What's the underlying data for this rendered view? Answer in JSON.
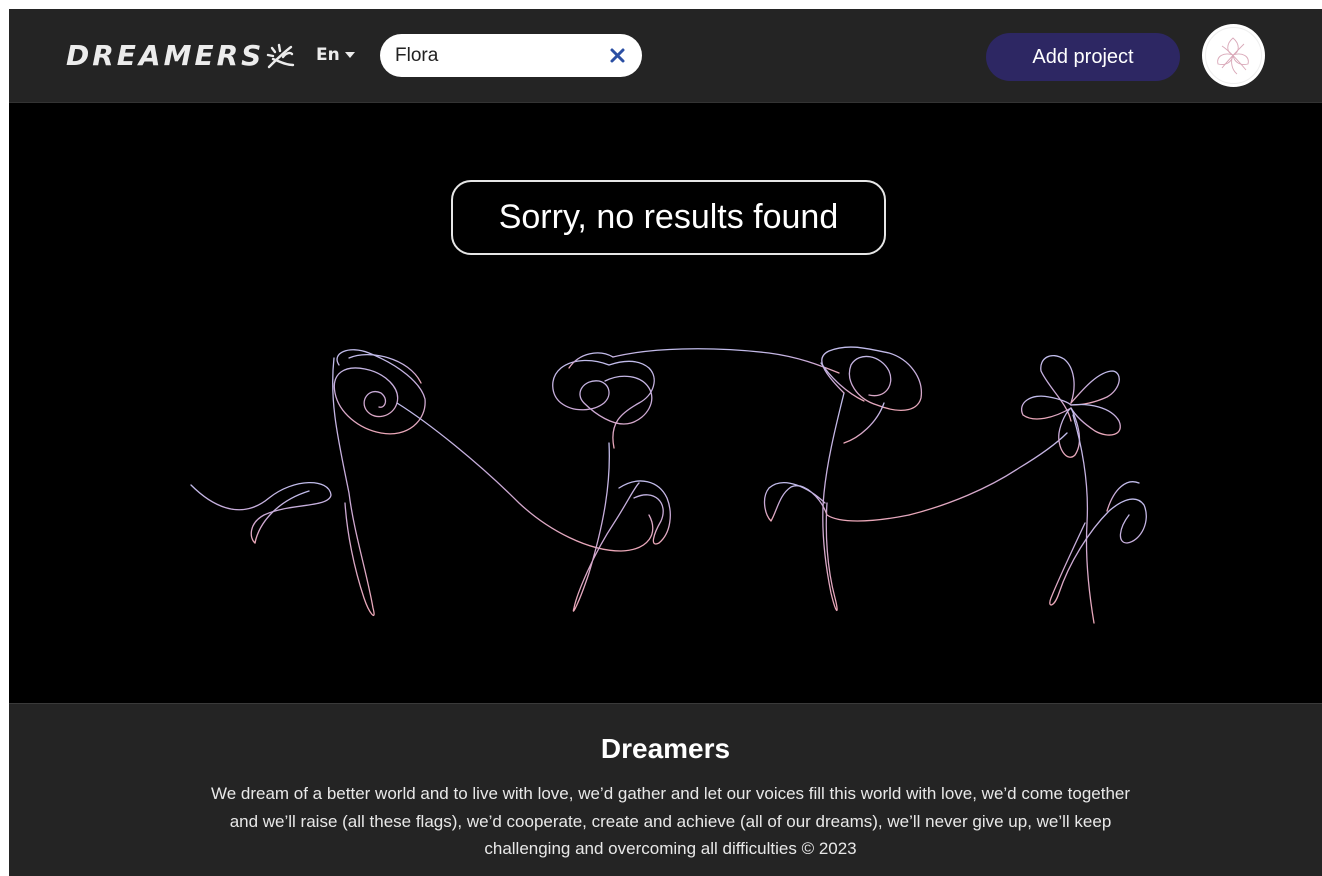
{
  "header": {
    "logo_text": "DREAMERS",
    "logo_icon": "dream-sparkle-icon",
    "language": "En",
    "search": {
      "value": "Flora",
      "placeholder": "",
      "clear_icon": "close-icon"
    },
    "add_project_label": "Add project",
    "avatar_icon": "flower-avatar"
  },
  "main": {
    "message": "Sorry, no results found",
    "illustration": "line-art-flowers"
  },
  "footer": {
    "title": "Dreamers",
    "text": "We dream of a better world and to live with love, we’d gather and let our voices fill this world with love, we’d come together and we’ll raise (all these flags), we’d cooperate, create and achieve (all of our dreams), we’ll never give up, we’ll keep challenging and overcoming all difficulties © 2023"
  },
  "colors": {
    "header_bg": "#242424",
    "main_bg": "#000000",
    "accent_button": "#2d2763",
    "search_clear": "#2b4fa3",
    "line_art_top": "#b8b4e6",
    "line_art_bottom": "#e6a6b8"
  }
}
